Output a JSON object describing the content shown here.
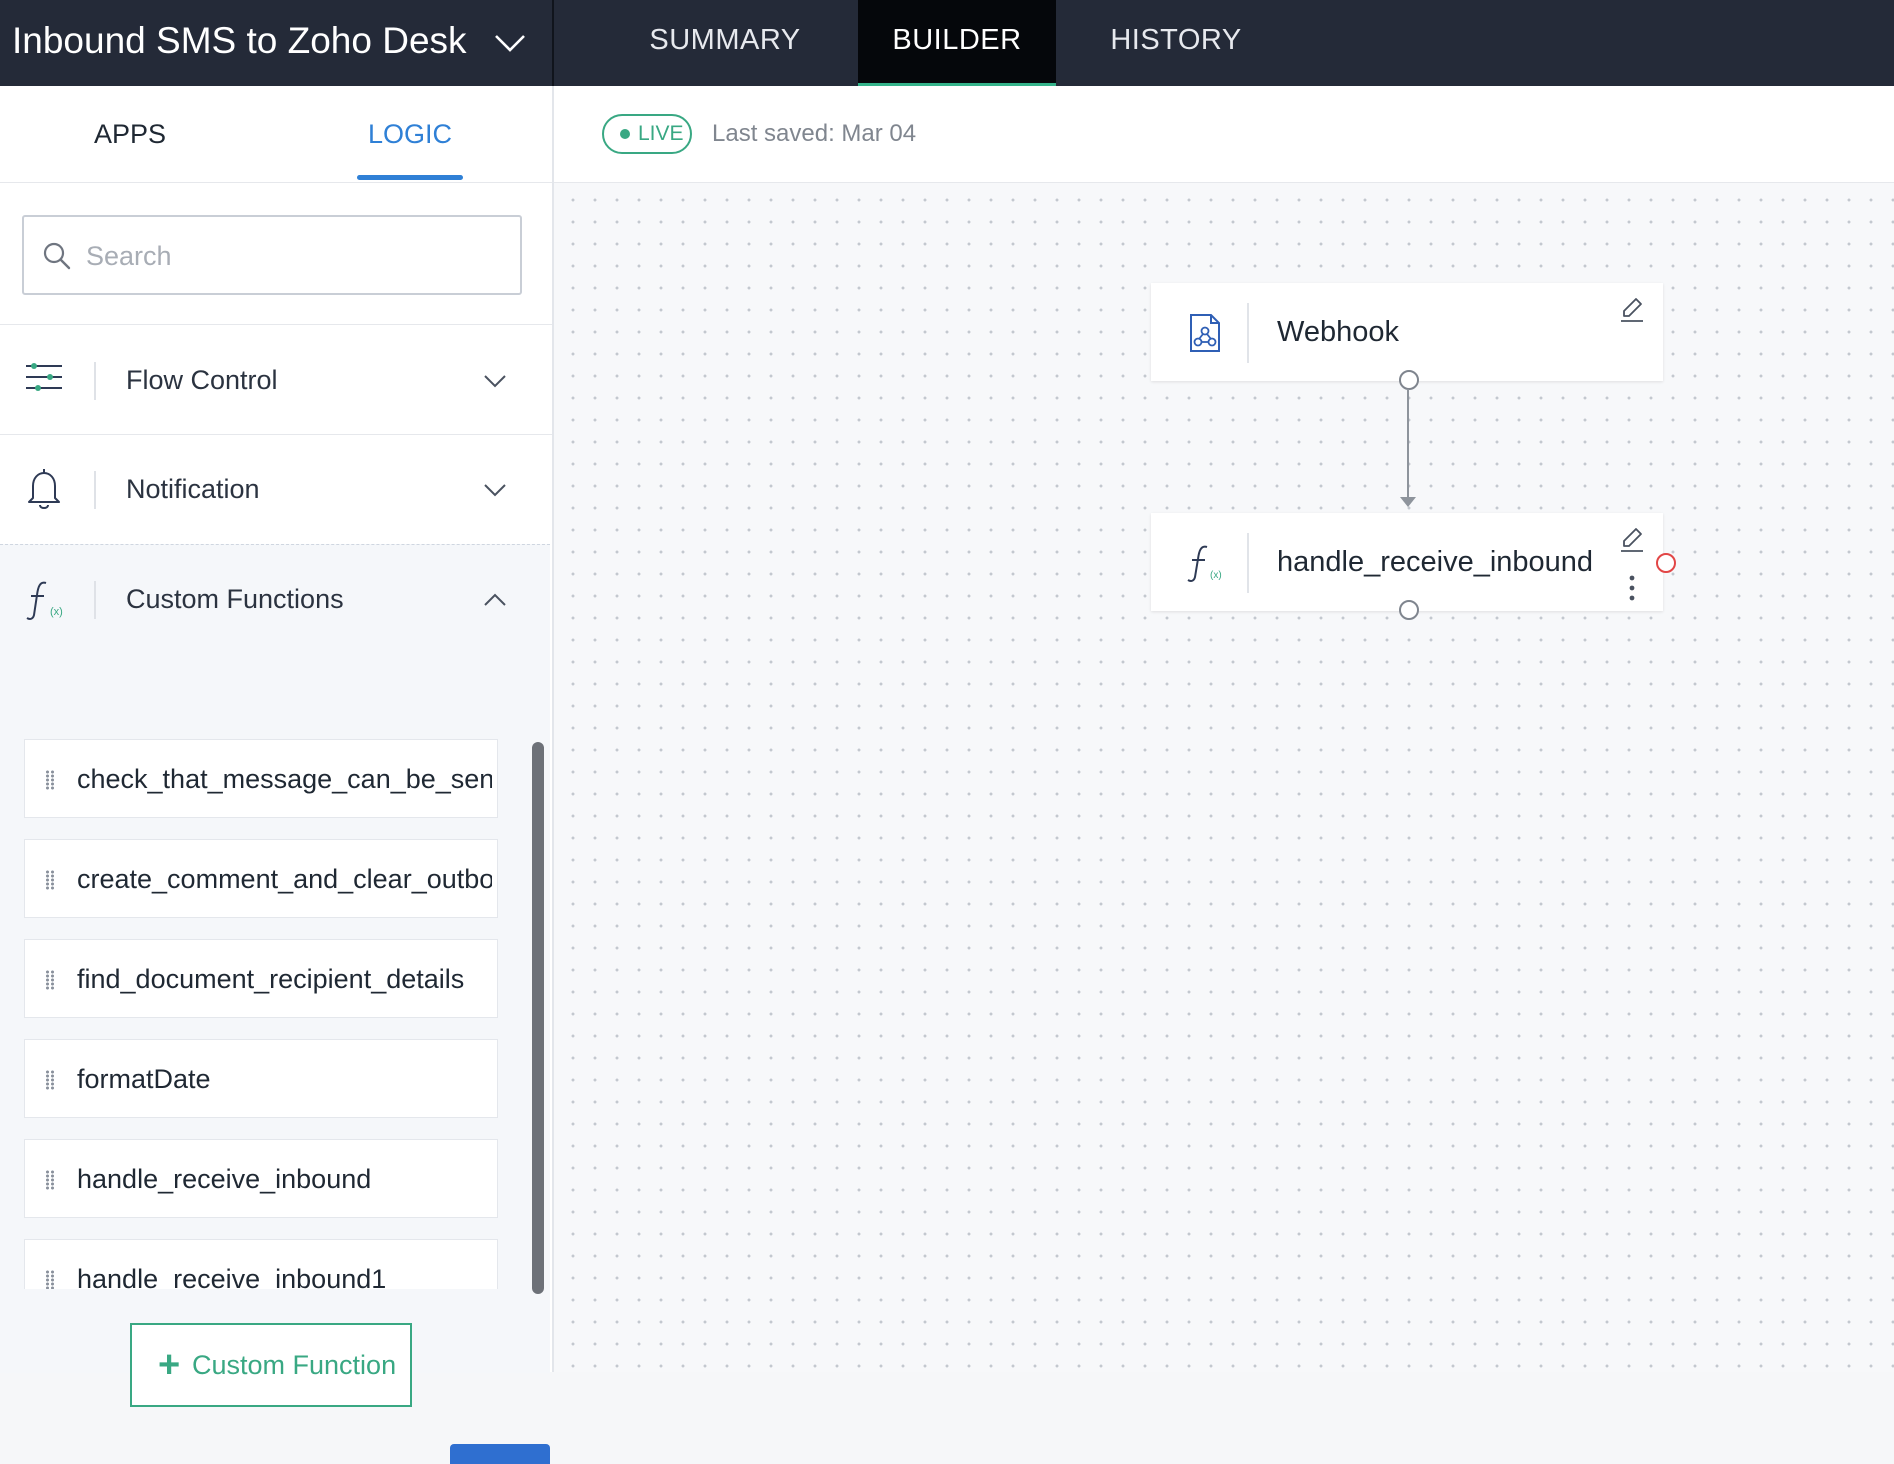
{
  "header": {
    "flow_title": "Inbound SMS to Zoho Desk",
    "tabs": [
      {
        "label": "SUMMARY",
        "active": false
      },
      {
        "label": "BUILDER",
        "active": true
      },
      {
        "label": "HISTORY",
        "active": false
      }
    ]
  },
  "sidebar": {
    "tabs": [
      {
        "label": "APPS",
        "active": false
      },
      {
        "label": "LOGIC",
        "active": true
      }
    ],
    "search": {
      "placeholder": "Search",
      "value": ""
    },
    "sections": [
      {
        "label": "Flow Control",
        "icon": "sliders-icon",
        "expanded": false
      },
      {
        "label": "Notification",
        "icon": "bell-icon",
        "expanded": false
      },
      {
        "label": "Custom Functions",
        "icon": "function-icon",
        "expanded": true
      }
    ],
    "custom_functions": [
      "check_that_message_can_be_sent",
      "create_comment_and_clear_outbound",
      "find_document_recipient_details",
      "formatDate",
      "handle_receive_inbound",
      "handle_receive_inbound1"
    ],
    "add_button_label": "Custom Function",
    "add_button_icon": "plus-icon"
  },
  "status": {
    "live_label": "LIVE",
    "last_saved": "Last saved: Mar 04"
  },
  "canvas": {
    "nodes": [
      {
        "title": "Webhook",
        "icon": "webhook-icon"
      },
      {
        "title": "handle_receive_inbound",
        "icon": "function-icon"
      }
    ]
  },
  "colors": {
    "topbar": "#242a38",
    "active_tab": "#05070b",
    "accent_blue": "#2f80d6",
    "accent_green": "#39a883",
    "error_red": "#e24646"
  }
}
